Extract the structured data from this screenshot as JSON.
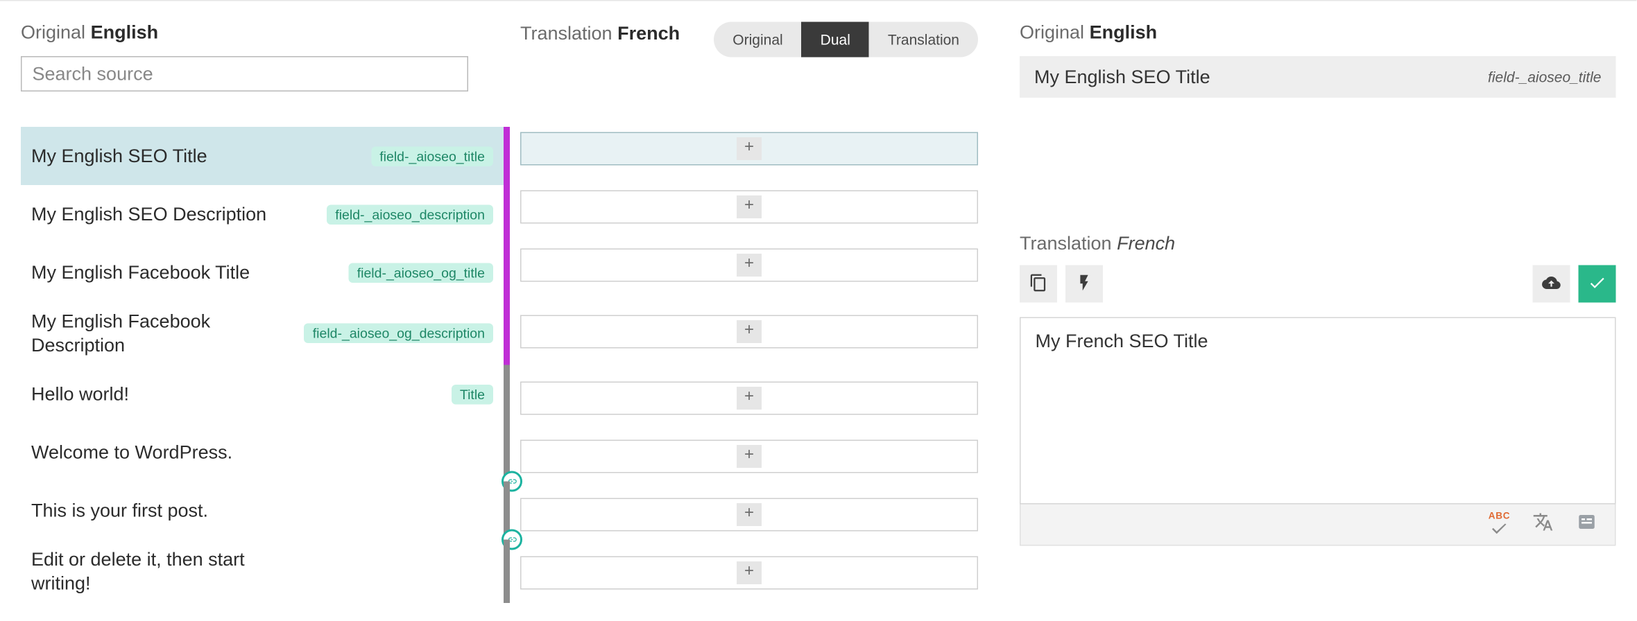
{
  "labels": {
    "original_prefix": "Original",
    "original_lang": "English",
    "translation_prefix": "Translation",
    "translation_lang": "French"
  },
  "search": {
    "placeholder": "Search source"
  },
  "view_modes": {
    "original": "Original",
    "dual": "Dual",
    "translation": "Translation",
    "active": "dual"
  },
  "rows": [
    {
      "text": "My English SEO Title",
      "badge": "field-_aioseo_title",
      "bar": "purple",
      "link": false,
      "selected": true
    },
    {
      "text": "My English SEO Description",
      "badge": "field-_aioseo_description",
      "bar": "purple",
      "link": false,
      "selected": false
    },
    {
      "text": "My English Facebook Title",
      "badge": "field-_aioseo_og_title",
      "bar": "purple",
      "link": false,
      "selected": false
    },
    {
      "text": "My English Facebook Description",
      "badge": "field-_aioseo_og_description",
      "bar": "purple",
      "link": false,
      "selected": false
    },
    {
      "text": "Hello world!",
      "badge": "Title",
      "bar": "grey",
      "link": false,
      "selected": false
    },
    {
      "text": "Welcome to WordPress.",
      "badge": null,
      "bar": "grey",
      "link": true,
      "selected": false
    },
    {
      "text": "This is your first post.",
      "badge": null,
      "bar": "grey",
      "link": true,
      "selected": false
    },
    {
      "text": "Edit or delete it, then start writing!",
      "badge": null,
      "bar": "grey",
      "link": false,
      "selected": false
    }
  ],
  "detail": {
    "original_text": "My English SEO Title",
    "original_field": "field-_aioseo_title",
    "translation_value": "My French SEO Title"
  },
  "footer_abc": "ABC",
  "plus_glyph": "+"
}
